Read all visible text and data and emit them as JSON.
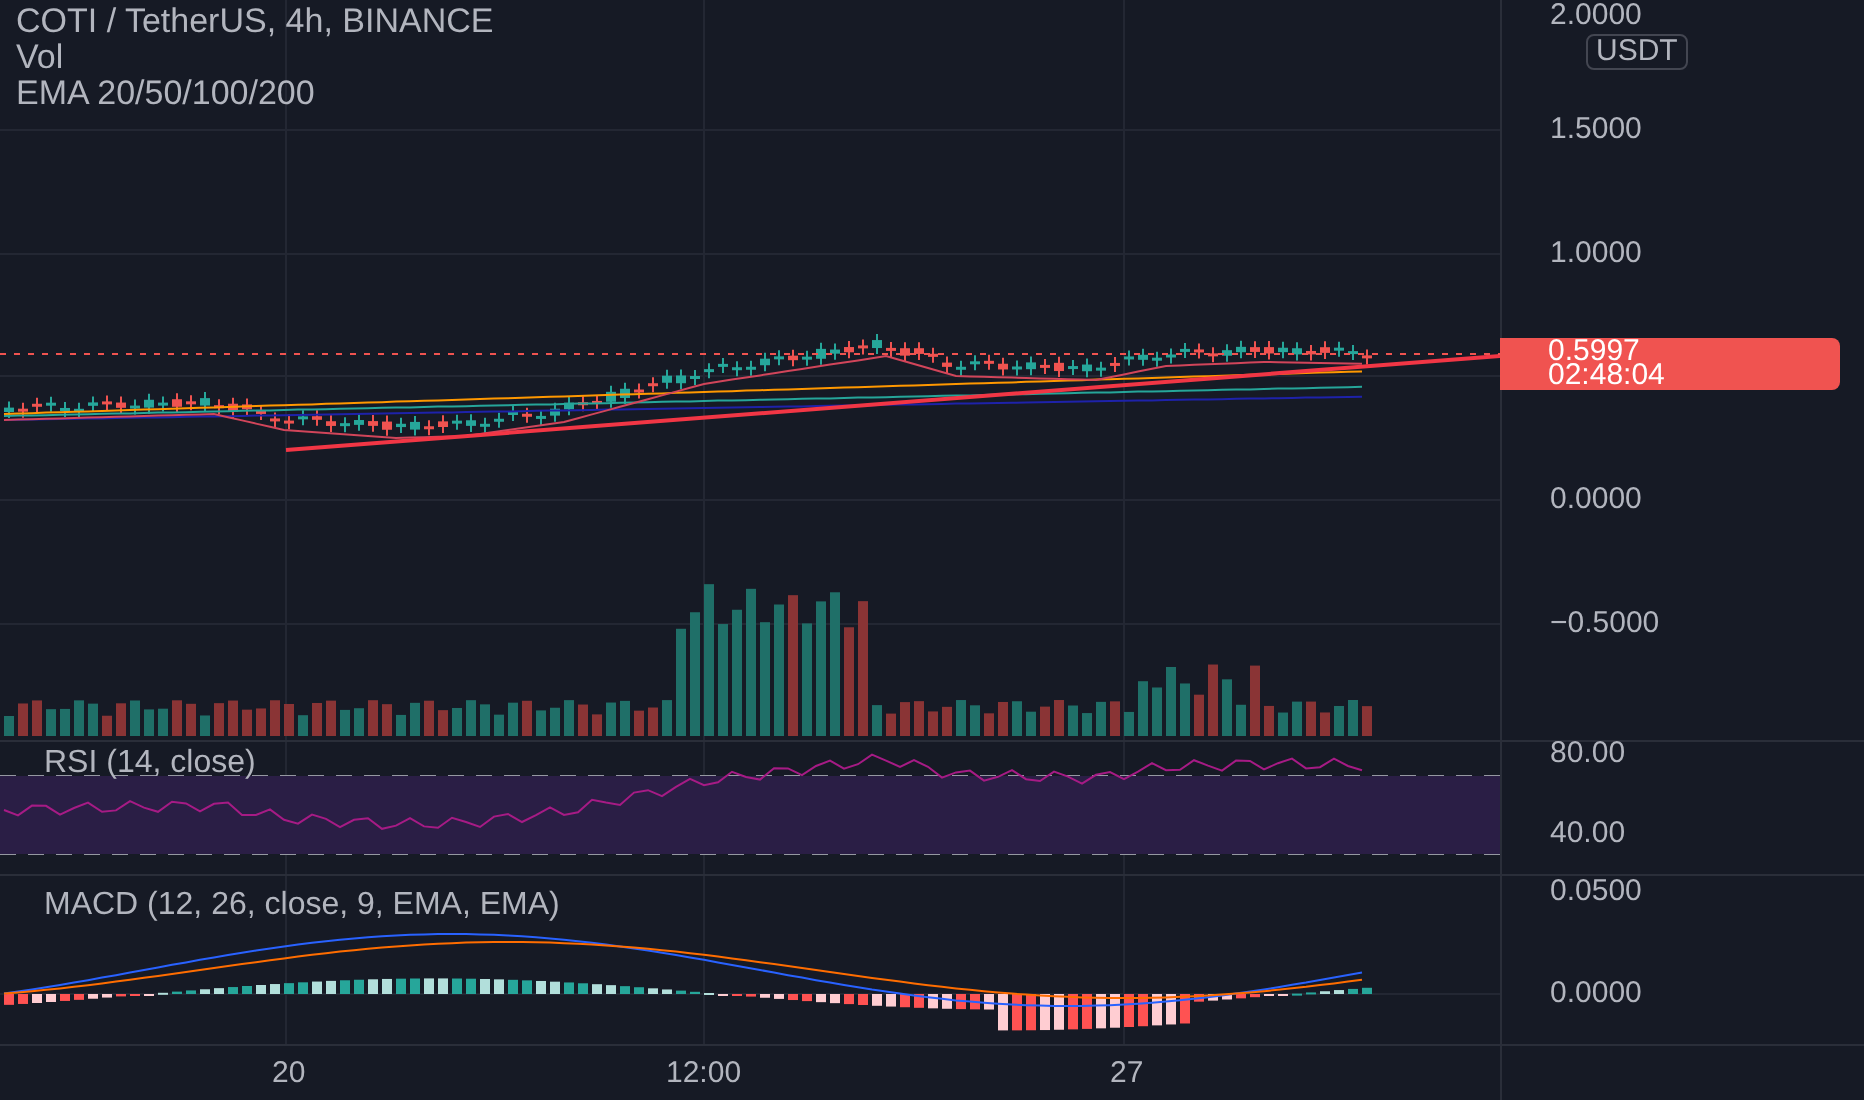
{
  "legend": {
    "symbol": "COTI / TetherUS, 4h, BINANCE",
    "volume": "Vol",
    "ema": "EMA 20/50/100/200"
  },
  "price_axis": {
    "unit": "USDT",
    "labels": [
      "2.0000",
      "1.5000",
      "1.0000",
      "0.0000",
      "−0.5000"
    ]
  },
  "price_tag": {
    "price": "0.5997",
    "countdown": "02:48:04"
  },
  "rsi": {
    "label": "RSI (14, close)",
    "axis_labels": [
      "80.00",
      "40.00"
    ]
  },
  "macd": {
    "label": "MACD (12, 26, close, 9, EMA, EMA)",
    "axis_labels": [
      "0.0500",
      "0.0000"
    ]
  },
  "time_axis": {
    "labels": [
      "20",
      "12:00",
      "27"
    ]
  }
}
